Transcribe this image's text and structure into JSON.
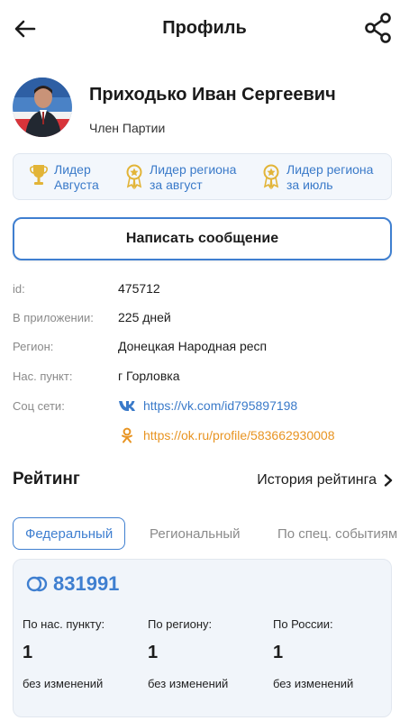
{
  "header": {
    "back_icon": "arrow-left-icon",
    "title": "Профиль",
    "share_icon": "share-icon"
  },
  "profile": {
    "name": "Приходько Иван Сергеевич",
    "role": "Член Партии"
  },
  "badges": [
    {
      "icon": "trophy-icon",
      "line1": "Лидер",
      "line2": "Августа"
    },
    {
      "icon": "medal-icon",
      "line1": "Лидер региона",
      "line2": "за август"
    },
    {
      "icon": "medal-icon",
      "line1": "Лидер региона",
      "line2": "за июль"
    }
  ],
  "actions": {
    "message_label": "Написать сообщение"
  },
  "info": [
    {
      "label": "id:",
      "value": "475712"
    },
    {
      "label": "В приложении:",
      "value": "225 дней"
    },
    {
      "label": "Регион:",
      "value": "Донецкая Народная респ"
    },
    {
      "label": "Нас. пункт:",
      "value": "г Горловка"
    },
    {
      "label": "Соц сети:",
      "value": ""
    }
  ],
  "social": [
    {
      "icon": "vk-icon",
      "url": "https://vk.com/id795897198",
      "color": "#3a7ac9"
    },
    {
      "icon": "odnoklassniki-icon",
      "url": "https://ok.ru/profile/583662930008",
      "color": "#e89422"
    }
  ],
  "rating": {
    "title": "Рейтинг",
    "history_label": "История рейтинга",
    "tabs": [
      "Федеральный",
      "Региональный",
      "По спец. событиям"
    ],
    "active_tab": "Федеральный",
    "score": "831991",
    "columns": [
      {
        "label": "По нас. пункту:",
        "value": "1",
        "change": "без изменений"
      },
      {
        "label": "По региону:",
        "value": "1",
        "change": "без изменений"
      },
      {
        "label": "По России:",
        "value": "1",
        "change": "без изменений"
      }
    ]
  },
  "colors": {
    "accent": "#3f7fd0",
    "ok_orange": "#e89422",
    "gold": "#e2b437"
  }
}
